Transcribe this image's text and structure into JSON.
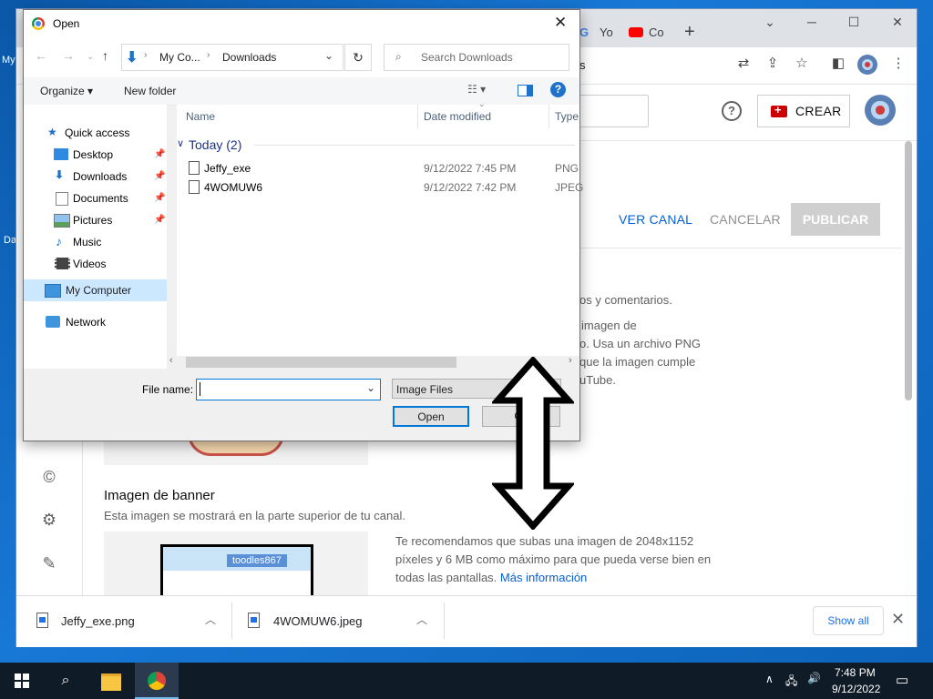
{
  "desktop": {
    "label_1": "My",
    "label_2": "Da"
  },
  "chrome": {
    "tabs": [
      "Yo",
      "Co"
    ],
    "new_tab": "+",
    "address_tail": "s",
    "controls": {
      "minimize": "─",
      "restore": "☐",
      "close": "✕",
      "tab_list": "⌄"
    }
  },
  "studio": {
    "crear_label": "CREAR",
    "help": "?",
    "ver_canal": "VER CANAL",
    "cancelar": "CANCELAR",
    "publicar": "PUBLICAR",
    "partial_lines": [
      "os y comentarios.",
      "imagen de",
      "o. Usa un archivo PNG",
      "que la imagen cumple",
      "uTube."
    ],
    "banner_title": "Imagen de banner",
    "banner_subtitle": "Esta imagen se mostrará en la parte superior de tu canal.",
    "banner_tag": "toodles867",
    "recommendation": "Te recomendamos que subas una imagen de 2048x1152 píxeles y 6 MB como máximo para que pueda verse bien en todas las pantallas.",
    "more_info": "Más información",
    "rail_icons": [
      "copyright-icon",
      "settings-icon",
      "feedback-icon"
    ]
  },
  "downloads": {
    "items": [
      {
        "name": "Jeffy_exe.png"
      },
      {
        "name": "4WOMUW6.jpeg"
      }
    ],
    "show_all": "Show all",
    "close": "✕"
  },
  "dialog": {
    "title": "Open",
    "close": "✕",
    "breadcrumb": [
      "My Co...",
      "Downloads"
    ],
    "search_placeholder": "Search Downloads",
    "organize": "Organize ▾",
    "new_folder": "New folder",
    "help": "?",
    "nav": {
      "quick_access": "Quick access",
      "quick_items": [
        "Desktop",
        "Downloads",
        "Documents",
        "Pictures",
        "Music",
        "Videos"
      ],
      "my_computer": "My Computer",
      "network": "Network"
    },
    "columns": [
      "Name",
      "Date modified",
      "Type"
    ],
    "group": "Today (2)",
    "files": [
      {
        "name": "Jeffy_exe",
        "date": "9/12/2022 7:45 PM",
        "type": "PNG"
      },
      {
        "name": "4WOMUW6",
        "date": "9/12/2022 7:42 PM",
        "type": "JPEG"
      }
    ],
    "file_name_label": "File name:",
    "file_name_value": "",
    "filter": "Image Files",
    "open_button": "Open",
    "cancel_button": "Ca"
  },
  "taskbar": {
    "time": "7:48 PM",
    "date": "9/12/2022"
  },
  "colors": {
    "accent": "#0078d7",
    "yt_link": "#065fd4",
    "yt_red": "#cc0000"
  }
}
